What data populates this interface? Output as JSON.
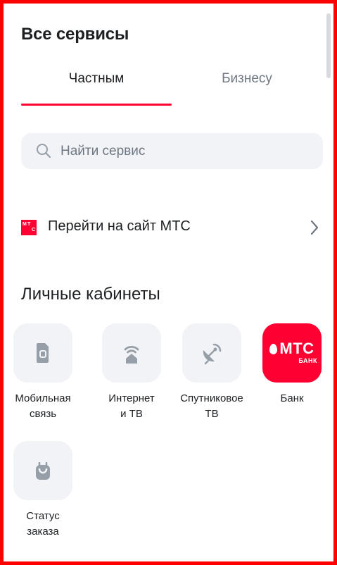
{
  "header": {
    "title": "Все сервисы"
  },
  "tabs": [
    {
      "label": "Частным",
      "active": true
    },
    {
      "label": "Бизнесу",
      "active": false
    }
  ],
  "search": {
    "placeholder": "Найти сервис",
    "value": ""
  },
  "mts_link": {
    "logo_text": [
      "М",
      "Т",
      "С"
    ],
    "label": "Перейти на сайт МТС"
  },
  "section": {
    "title": "Личные кабинеты"
  },
  "services": [
    {
      "label": "Мобильная\nсвязь",
      "icon": "sim-card-icon"
    },
    {
      "label": "Интернет\nи ТВ",
      "icon": "wifi-house-icon"
    },
    {
      "label": "Спутниковое\nТВ",
      "icon": "satellite-dish-icon"
    },
    {
      "label": "Банк",
      "icon": "mts-bank-logo",
      "logo_text": "МТС",
      "logo_subtext": "БАНК"
    },
    {
      "label": "Статус\nзаказа",
      "icon": "shopping-bag-icon"
    }
  ],
  "colors": {
    "accent": "#ff0032",
    "tile_bg": "#f2f3f7",
    "icon": "#969fa8",
    "text": "#1d2023",
    "muted": "#6e7782",
    "frame": "#ff0000"
  }
}
